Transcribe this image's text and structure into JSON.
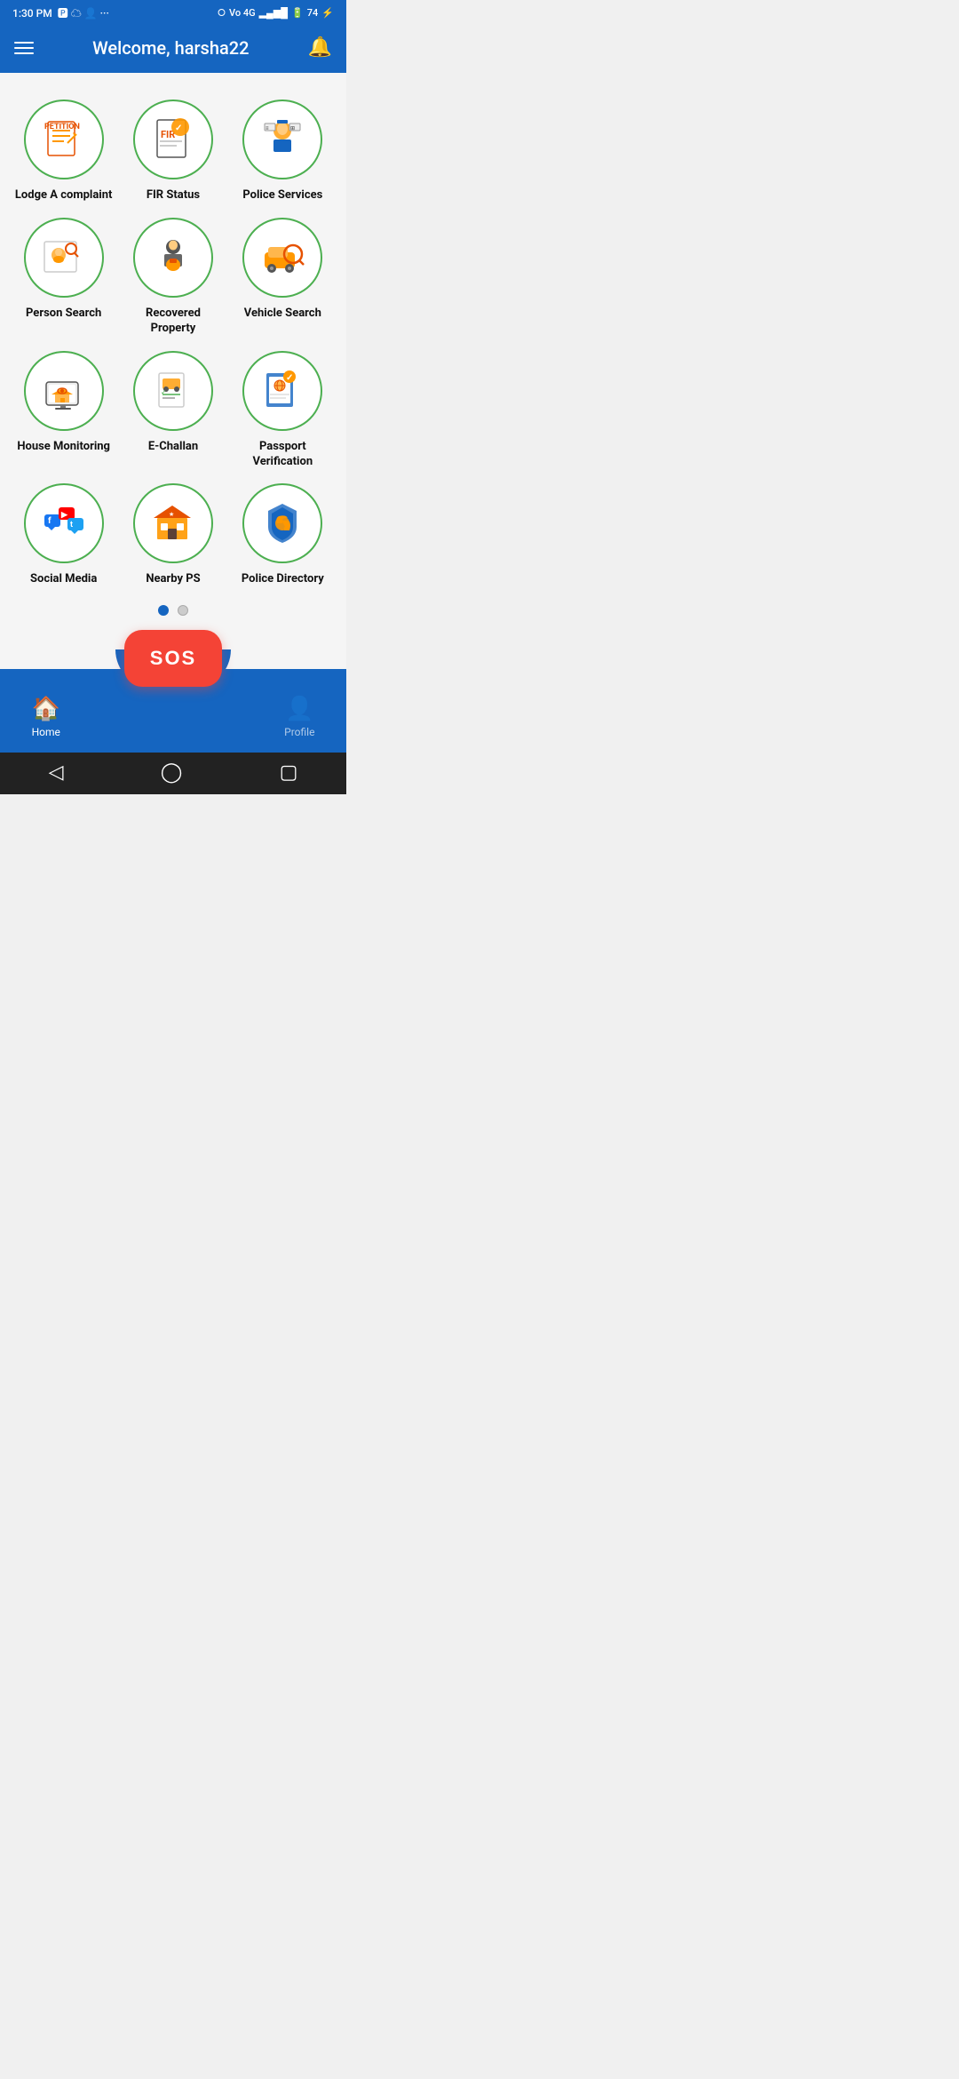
{
  "statusBar": {
    "time": "1:30 PM",
    "batteryLevel": "74"
  },
  "header": {
    "title": "Welcome, harsha22",
    "menu_label": "menu",
    "bell_label": "notifications"
  },
  "grid": {
    "items": [
      {
        "id": "lodge-complaint",
        "label": "Lodge A complaint",
        "icon": "petition"
      },
      {
        "id": "fir-status",
        "label": "FIR Status",
        "icon": "fir"
      },
      {
        "id": "police-services",
        "label": "Police Services",
        "icon": "police-services"
      },
      {
        "id": "person-search",
        "label": "Person Search",
        "icon": "person-search"
      },
      {
        "id": "recovered-property",
        "label": "Recovered Property",
        "icon": "recovered"
      },
      {
        "id": "vehicle-search",
        "label": "Vehicle Search",
        "icon": "vehicle"
      },
      {
        "id": "house-monitoring",
        "label": "House Monitoring",
        "icon": "house"
      },
      {
        "id": "e-challan",
        "label": "E-Challan",
        "icon": "challan"
      },
      {
        "id": "passport-verification",
        "label": "Passport Verification",
        "icon": "passport"
      },
      {
        "id": "social-media",
        "label": "Social Media",
        "icon": "social"
      },
      {
        "id": "nearby-ps",
        "label": "Nearby PS",
        "icon": "nearby"
      },
      {
        "id": "police-directory",
        "label": "Police Directory",
        "icon": "directory"
      }
    ]
  },
  "sos": {
    "label": "SOS"
  },
  "bottomNav": {
    "home_label": "Home",
    "profile_label": "Profile"
  },
  "colors": {
    "primary": "#1565C0",
    "accent": "#FF9800",
    "green": "#4CAF50",
    "sos": "#f44336"
  }
}
